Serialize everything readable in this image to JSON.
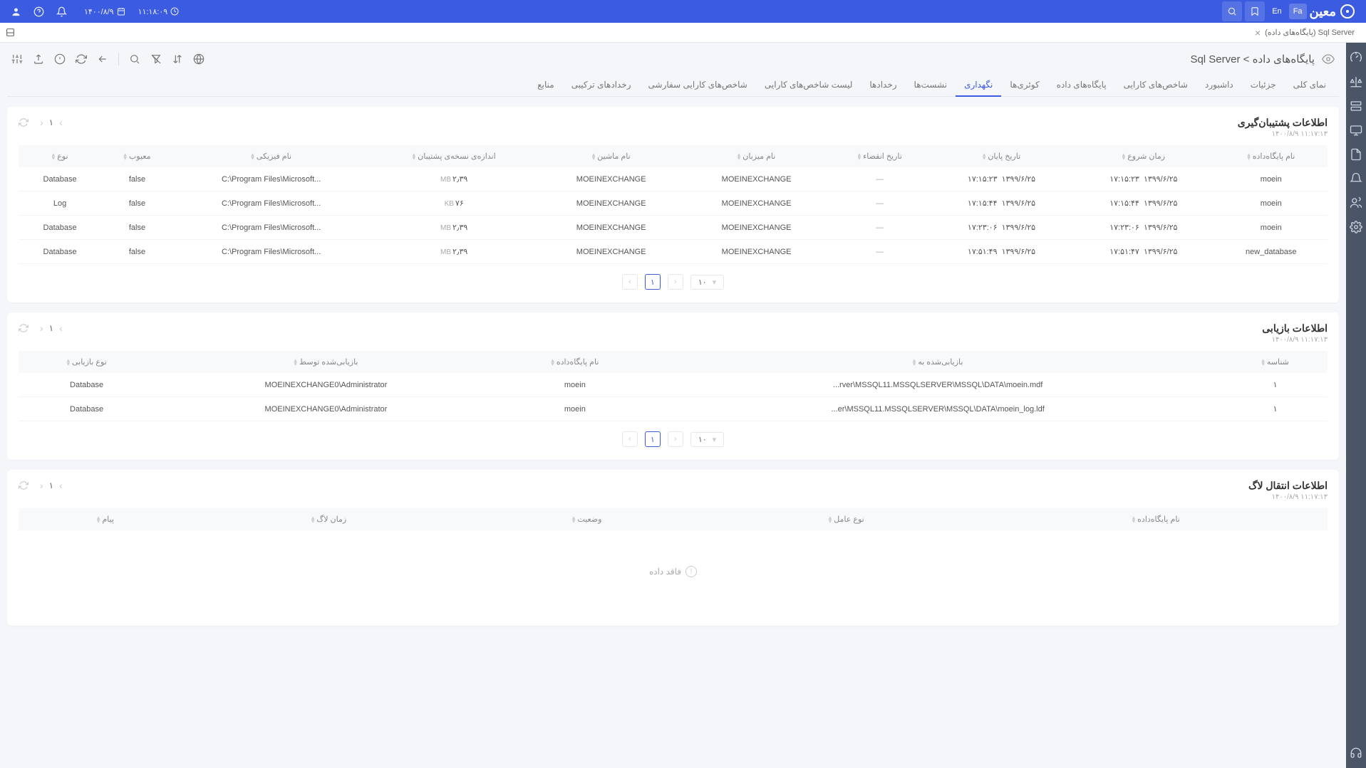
{
  "topbar": {
    "date": "۱۴۰۰/۸/۹",
    "time": "۱۱:۱۸:۰۹",
    "lang_en": "En",
    "lang_fa": "Fa",
    "brand": "معین"
  },
  "tabstrip": {
    "tab_label": "Sql Server (پایگاه‌های داده)"
  },
  "page": {
    "breadcrumb": "پایگاه‌های داده > Sql Server"
  },
  "main_tabs": [
    "نمای کلی",
    "جزئیات",
    "داشبورد",
    "شاخص‌های کارایی",
    "پایگاه‌های داده",
    "کوئری‌ها",
    "نگهداری",
    "نشست‌ها",
    "رخدادها",
    "لیست شاخص‌های کارایی",
    "شاخص‌های کارایی سفارشی",
    "رخدادهای ترکیبی",
    "منابع"
  ],
  "active_tab_index": 6,
  "panel1": {
    "title": "اطلاعات پشتیبان‌گیری",
    "timestamp": "۱۱:۱۷:۱۳   ۱۴۰۰/۸/۹",
    "page_num": "۱",
    "headers": [
      "نام پایگاه‌داده",
      "زمان شروع",
      "تاریخ پایان",
      "تاریخ انقضاء",
      "نام میزبان",
      "نام ماشین",
      "اندازه‌ی نسخه‌ی پشتیبان",
      "نام فیزیکی",
      "معیوب",
      "نوع"
    ],
    "rows": [
      {
        "db": "moein",
        "start_d": "۱۳۹۹/۶/۲۵",
        "start_t": "۱۷:۱۵:۲۳",
        "end_d": "۱۳۹۹/۶/۲۵",
        "end_t": "۱۷:۱۵:۲۳",
        "exp": "—",
        "host": "MOEINEXCHANGE",
        "machine": "MOEINEXCHANGE",
        "size_v": "۲٫۳۹",
        "size_u": "MB",
        "path": "C:\\Program Files\\Microsoft...",
        "corrupt": "false",
        "type": "Database"
      },
      {
        "db": "moein",
        "start_d": "۱۳۹۹/۶/۲۵",
        "start_t": "۱۷:۱۵:۴۴",
        "end_d": "۱۳۹۹/۶/۲۵",
        "end_t": "۱۷:۱۵:۴۴",
        "exp": "—",
        "host": "MOEINEXCHANGE",
        "machine": "MOEINEXCHANGE",
        "size_v": "۷۶",
        "size_u": "KB",
        "path": "C:\\Program Files\\Microsoft...",
        "corrupt": "false",
        "type": "Log"
      },
      {
        "db": "moein",
        "start_d": "۱۳۹۹/۶/۲۵",
        "start_t": "۱۷:۲۳:۰۶",
        "end_d": "۱۳۹۹/۶/۲۵",
        "end_t": "۱۷:۲۳:۰۶",
        "exp": "—",
        "host": "MOEINEXCHANGE",
        "machine": "MOEINEXCHANGE",
        "size_v": "۲٫۳۹",
        "size_u": "MB",
        "path": "C:\\Program Files\\Microsoft...",
        "corrupt": "false",
        "type": "Database"
      },
      {
        "db": "new_database",
        "start_d": "۱۳۹۹/۶/۲۵",
        "start_t": "۱۷:۵۱:۴۷",
        "end_d": "۱۳۹۹/۶/۲۵",
        "end_t": "۱۷:۵۱:۴۹",
        "exp": "—",
        "host": "MOEINEXCHANGE",
        "machine": "MOEINEXCHANGE",
        "size_v": "۲٫۳۹",
        "size_u": "MB",
        "path": "C:\\Program Files\\Microsoft...",
        "corrupt": "false",
        "type": "Database"
      }
    ],
    "page_size": "۱۰",
    "page_current": "۱"
  },
  "panel2": {
    "title": "اطلاعات بازیابی",
    "timestamp": "۱۱:۱۷:۱۳   ۱۴۰۰/۸/۹",
    "page_num": "۱",
    "headers": [
      "شناسه",
      "بازیابی‌شده به",
      "نام پایگاه‌داده",
      "بازیابی‌شده توسط",
      "نوع بازیابی"
    ],
    "rows": [
      {
        "id": "۱",
        "dest": "...rver\\MSSQL11.MSSQLSERVER\\MSSQL\\DATA\\moein.mdf",
        "db": "moein",
        "by": "MOEINEXCHANGE0\\Administrator",
        "type": "Database"
      },
      {
        "id": "۱",
        "dest": "...er\\MSSQL11.MSSQLSERVER\\MSSQL\\DATA\\moein_log.ldf",
        "db": "moein",
        "by": "MOEINEXCHANGE0\\Administrator",
        "type": "Database"
      }
    ],
    "page_size": "۱۰",
    "page_current": "۱"
  },
  "panel3": {
    "title": "اطلاعات انتقال لاگ",
    "timestamp": "۱۱:۱۷:۱۳   ۱۴۰۰/۸/۹",
    "page_num": "۱",
    "headers": [
      "نام پایگاه‌داده",
      "نوع عامل",
      "وضعیت",
      "زمان لاگ",
      "پیام"
    ],
    "empty_text": "فاقد داده"
  }
}
